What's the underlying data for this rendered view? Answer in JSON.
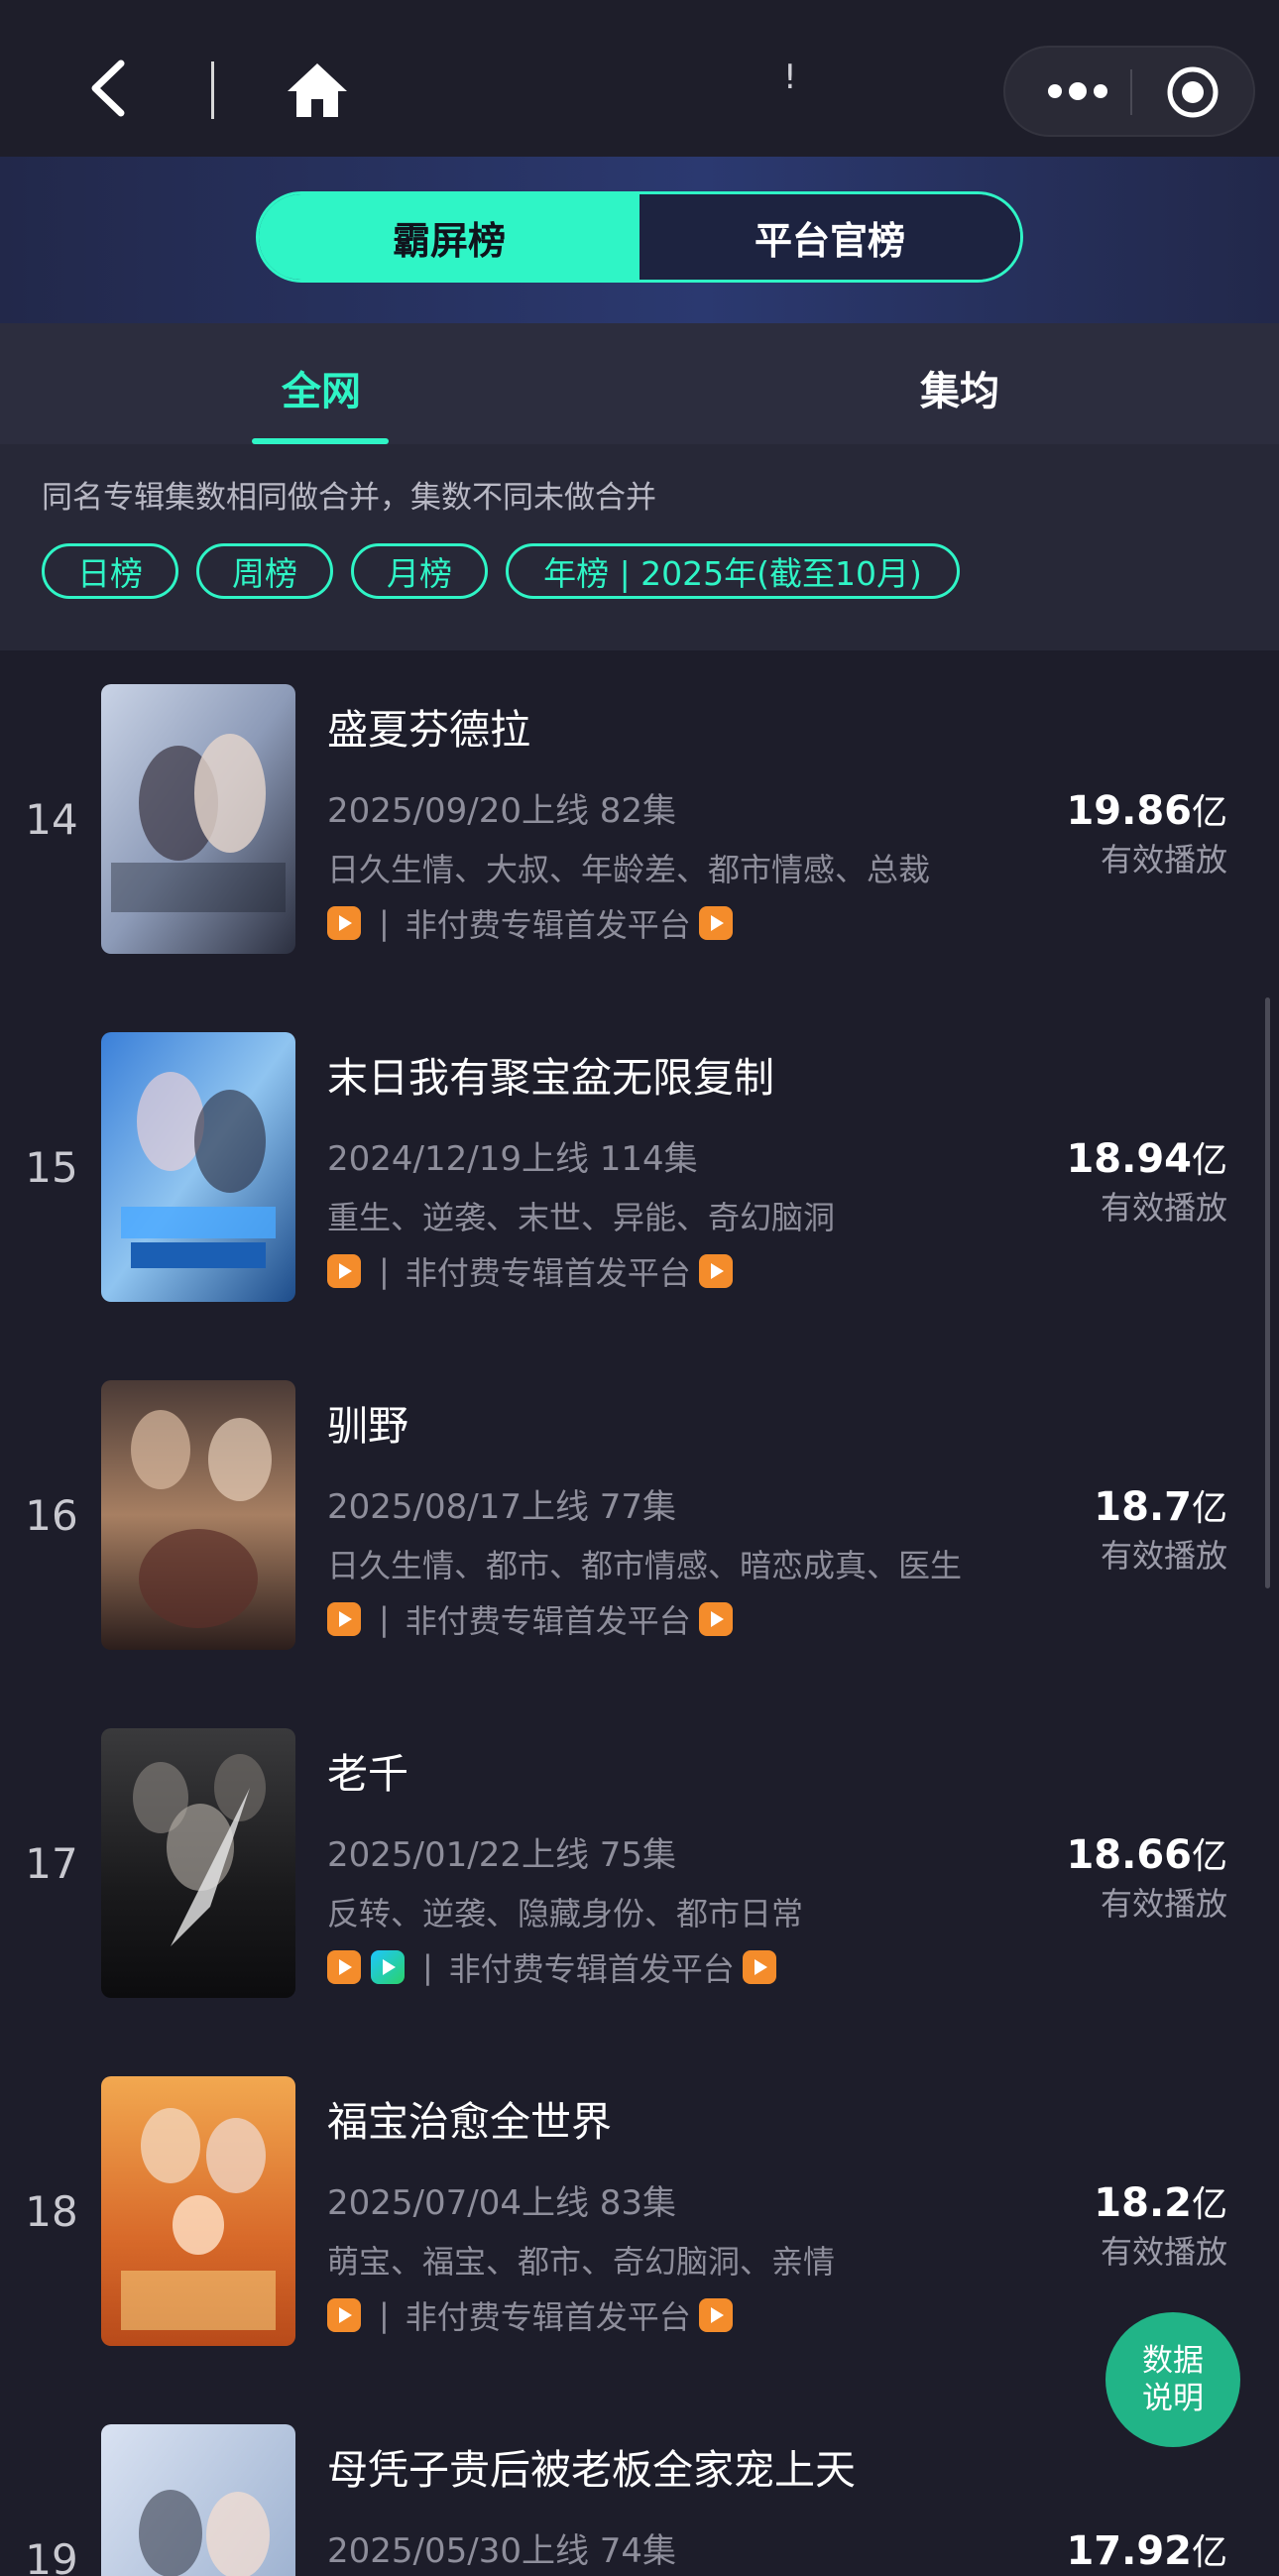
{
  "nav": {
    "back_icon": "chevron-left-icon",
    "home_icon": "home-icon",
    "more_icon": "more-dots-icon",
    "close_icon": "target-circle-icon",
    "title_partial": "!"
  },
  "segments": [
    "霸屏榜",
    "平台官榜"
  ],
  "tabs": [
    "全网",
    "集均"
  ],
  "note": "同名专辑集数相同做合并，集数不同未做合并",
  "chips": [
    "日榜",
    "周榜",
    "月榜",
    "年榜 | 2025年(截至10月)"
  ],
  "platform_text": "非付费专辑首发平台",
  "platform_separator": "|",
  "value_label": "有效播放",
  "value_unit": "亿",
  "float_button": [
    "数据",
    "说明"
  ],
  "colors": {
    "accent": "#2ff5c6",
    "bg": "#1d1d2a",
    "float": "#21b487",
    "platform_icon": "#f48c2b"
  },
  "items": [
    {
      "rank": "14",
      "title": "盛夏芬德拉",
      "meta": "2025/09/20上线 82集",
      "tags": "日久生情、大叔、年龄差、都市情感、总裁",
      "value": "19.86",
      "icons": [
        "orange"
      ]
    },
    {
      "rank": "15",
      "title": "末日我有聚宝盆无限复制",
      "meta": "2024/12/19上线 114集",
      "tags": "重生、逆袭、末世、异能、奇幻脑洞",
      "value": "18.94",
      "icons": [
        "orange"
      ]
    },
    {
      "rank": "16",
      "title": "驯野",
      "meta": "2025/08/17上线 77集",
      "tags": "日久生情、都市、都市情感、暗恋成真、医生",
      "value": "18.7",
      "icons": [
        "orange"
      ]
    },
    {
      "rank": "17",
      "title": "老千",
      "meta": "2025/01/22上线 75集",
      "tags": "反转、逆袭、隐藏身份、都市日常",
      "value": "18.66",
      "icons": [
        "orange",
        "blue"
      ]
    },
    {
      "rank": "18",
      "title": "福宝治愈全世界",
      "meta": "2025/07/04上线 83集",
      "tags": "萌宝、福宝、都市、奇幻脑洞、亲情",
      "value": "18.2",
      "icons": [
        "orange"
      ]
    },
    {
      "rank": "19",
      "title": "母凭子贵后被老板全家宠上天",
      "meta": "2025/05/30上线 74集",
      "tags": "",
      "value": "17.92",
      "icons": []
    }
  ]
}
